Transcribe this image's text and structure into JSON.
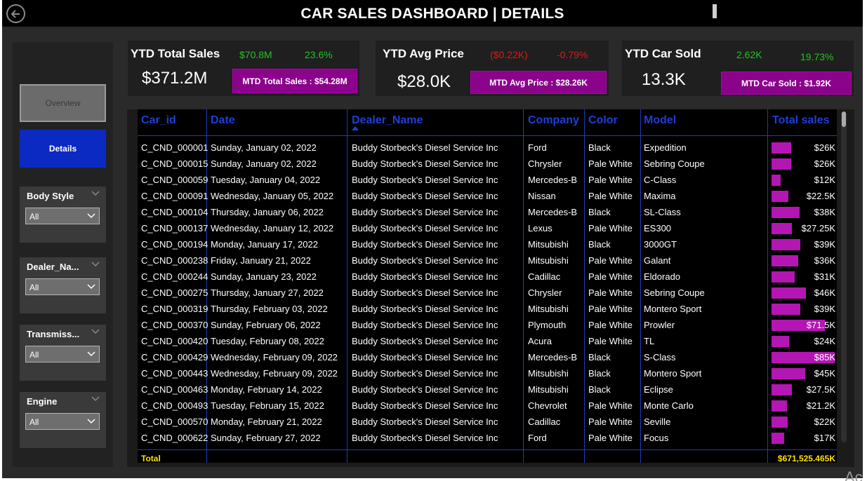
{
  "header": {
    "title": "CAR SALES DASHBOARD | DETAILS"
  },
  "nav": {
    "overview_label": "Overview",
    "details_label": "Details"
  },
  "slicers": [
    {
      "label": "Body Style",
      "value": "All"
    },
    {
      "label": "Dealer_Na...",
      "value": "All"
    },
    {
      "label": "Transmiss...",
      "value": "All"
    },
    {
      "label": "Engine",
      "value": "All"
    }
  ],
  "kpis": {
    "sales": {
      "title": "YTD Total Sales",
      "value": "$371.2M",
      "delta_abs": "$70.8M",
      "delta_pct": "23.6%",
      "mtd": "MTD Total Sales : $54.28M"
    },
    "price": {
      "title": "YTD Avg Price",
      "value": "$28.0K",
      "delta_abs": "($0.22K)",
      "delta_pct": "-0.79%",
      "mtd": "MTD Avg Price : $28.26K"
    },
    "sold": {
      "title": "YTD Car Sold",
      "value": "13.3K",
      "delta_abs": "2.62K",
      "delta_pct": "19.73%",
      "mtd": "MTD Car Sold : $1.92K"
    }
  },
  "colors": {
    "positive": "#22c322",
    "negative": "#d81b1b",
    "accent": "#8b028b",
    "header_blue": "#1e3fd6",
    "nav_active": "#0b2ac2",
    "total_yellow": "#ffe100",
    "bar": "#b416b4"
  },
  "table": {
    "columns": [
      "Car_id",
      "Date",
      "Dealer_Name",
      "Company",
      "Color",
      "Model",
      "Total sales"
    ],
    "sorted_column": "Dealer_Name",
    "rows": [
      {
        "id": "C_CND_000001",
        "date": "Sunday, January 02, 2022",
        "dealer": "Buddy Storbeck's Diesel Service Inc",
        "company": "Ford",
        "color": "Black",
        "model": "Expedition",
        "sales": "$26K",
        "value": 26
      },
      {
        "id": "C_CND_000015",
        "date": "Sunday, January 02, 2022",
        "dealer": "Buddy Storbeck's Diesel Service Inc",
        "company": "Chrysler",
        "color": "Pale White",
        "model": "Sebring Coupe",
        "sales": "$26K",
        "value": 26
      },
      {
        "id": "C_CND_000059",
        "date": "Tuesday, January 04, 2022",
        "dealer": "Buddy Storbeck's Diesel Service Inc",
        "company": "Mercedes-B",
        "color": "Pale White",
        "model": "C-Class",
        "sales": "$12K",
        "value": 12
      },
      {
        "id": "C_CND_000091",
        "date": "Wednesday, January 05, 2022",
        "dealer": "Buddy Storbeck's Diesel Service Inc",
        "company": "Nissan",
        "color": "Pale White",
        "model": "Maxima",
        "sales": "$22.5K",
        "value": 22.5
      },
      {
        "id": "C_CND_000104",
        "date": "Thursday, January 06, 2022",
        "dealer": "Buddy Storbeck's Diesel Service Inc",
        "company": "Mercedes-B",
        "color": "Black",
        "model": "SL-Class",
        "sales": "$38K",
        "value": 38
      },
      {
        "id": "C_CND_000137",
        "date": "Wednesday, January 12, 2022",
        "dealer": "Buddy Storbeck's Diesel Service Inc",
        "company": "Lexus",
        "color": "Pale White",
        "model": "ES300",
        "sales": "$27.25K",
        "value": 27.25
      },
      {
        "id": "C_CND_000194",
        "date": "Monday, January 17, 2022",
        "dealer": "Buddy Storbeck's Diesel Service Inc",
        "company": "Mitsubishi",
        "color": "Black",
        "model": "3000GT",
        "sales": "$39K",
        "value": 39
      },
      {
        "id": "C_CND_000238",
        "date": "Friday, January 21, 2022",
        "dealer": "Buddy Storbeck's Diesel Service Inc",
        "company": "Mitsubishi",
        "color": "Pale White",
        "model": "Galant",
        "sales": "$36K",
        "value": 36
      },
      {
        "id": "C_CND_000244",
        "date": "Sunday, January 23, 2022",
        "dealer": "Buddy Storbeck's Diesel Service Inc",
        "company": "Cadillac",
        "color": "Pale White",
        "model": "Eldorado",
        "sales": "$31K",
        "value": 31
      },
      {
        "id": "C_CND_000275",
        "date": "Thursday, January 27, 2022",
        "dealer": "Buddy Storbeck's Diesel Service Inc",
        "company": "Chrysler",
        "color": "Pale White",
        "model": "Sebring Coupe",
        "sales": "$46K",
        "value": 46
      },
      {
        "id": "C_CND_000319",
        "date": "Thursday, February 03, 2022",
        "dealer": "Buddy Storbeck's Diesel Service Inc",
        "company": "Mitsubishi",
        "color": "Pale White",
        "model": "Montero Sport",
        "sales": "$39K",
        "value": 39
      },
      {
        "id": "C_CND_000370",
        "date": "Sunday, February 06, 2022",
        "dealer": "Buddy Storbeck's Diesel Service Inc",
        "company": "Plymouth",
        "color": "Pale White",
        "model": "Prowler",
        "sales": "$71.5K",
        "value": 71.5
      },
      {
        "id": "C_CND_000420",
        "date": "Tuesday, February 08, 2022",
        "dealer": "Buddy Storbeck's Diesel Service Inc",
        "company": "Acura",
        "color": "Pale White",
        "model": "TL",
        "sales": "$24K",
        "value": 24
      },
      {
        "id": "C_CND_000429",
        "date": "Wednesday, February 09, 2022",
        "dealer": "Buddy Storbeck's Diesel Service Inc",
        "company": "Mercedes-B",
        "color": "Black",
        "model": "S-Class",
        "sales": "$85K",
        "value": 85
      },
      {
        "id": "C_CND_000443",
        "date": "Wednesday, February 09, 2022",
        "dealer": "Buddy Storbeck's Diesel Service Inc",
        "company": "Mitsubishi",
        "color": "Black",
        "model": "Montero Sport",
        "sales": "$45K",
        "value": 45
      },
      {
        "id": "C_CND_000463",
        "date": "Monday, February 14, 2022",
        "dealer": "Buddy Storbeck's Diesel Service Inc",
        "company": "Mitsubishi",
        "color": "Black",
        "model": "Eclipse",
        "sales": "$27.5K",
        "value": 27.5
      },
      {
        "id": "C_CND_000493",
        "date": "Tuesday, February 15, 2022",
        "dealer": "Buddy Storbeck's Diesel Service Inc",
        "company": "Chevrolet",
        "color": "Pale White",
        "model": "Monte Carlo",
        "sales": "$21.2K",
        "value": 21.2
      },
      {
        "id": "C_CND_000570",
        "date": "Monday, February 21, 2022",
        "dealer": "Buddy Storbeck's Diesel Service Inc",
        "company": "Cadillac",
        "color": "Pale White",
        "model": "Seville",
        "sales": "$22K",
        "value": 22
      },
      {
        "id": "C_CND_000622",
        "date": "Sunday, February 27, 2022",
        "dealer": "Buddy Storbeck's Diesel Service Inc",
        "company": "Ford",
        "color": "Pale White",
        "model": "Focus",
        "sales": "$17K",
        "value": 17
      }
    ],
    "total_label": "Total",
    "total_value": "$671,525.465K"
  },
  "watermark": "Ac"
}
